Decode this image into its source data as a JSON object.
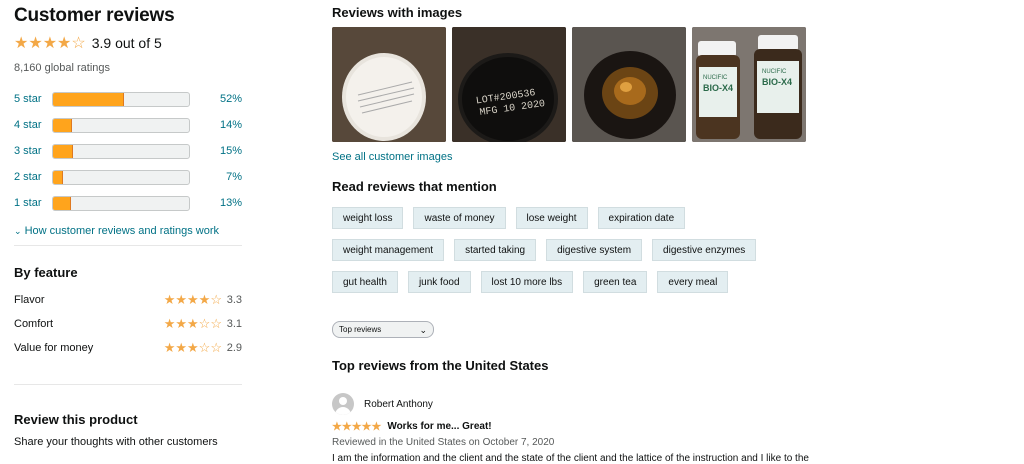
{
  "summary": {
    "title": "Customer reviews",
    "stars": "★★★★☆",
    "rating_text": "3.9 out of 5",
    "global_ratings": "8,160 global ratings",
    "histogram": [
      {
        "label": "5 star",
        "percent": 52,
        "pct_text": "52%"
      },
      {
        "label": "4 star",
        "percent": 14,
        "pct_text": "14%"
      },
      {
        "label": "3 star",
        "percent": 15,
        "pct_text": "15%"
      },
      {
        "label": "2 star",
        "percent": 7,
        "pct_text": "7%"
      },
      {
        "label": "1 star",
        "percent": 13,
        "pct_text": "13%"
      }
    ],
    "how_link": "How customer reviews and ratings work"
  },
  "by_feature": {
    "title": "By feature",
    "items": [
      {
        "label": "Flavor",
        "stars": "★★★★☆",
        "value": "3.3"
      },
      {
        "label": "Comfort",
        "stars": "★★★☆☆",
        "value": "3.1"
      },
      {
        "label": "Value for money",
        "stars": "★★★☆☆",
        "value": "2.9"
      }
    ]
  },
  "review_product": {
    "title": "Review this product",
    "subtitle": "Share your thoughts with other customers"
  },
  "images": {
    "title": "Reviews with images",
    "see_all": "See all customer images",
    "thumb_texts": {
      "thumb2_line1": "LOT#200536",
      "thumb2_line2": "MFG 10 2020",
      "thumb4_brand": "NUCIFIC",
      "thumb4_product": "BIO-X4"
    }
  },
  "mentions": {
    "title": "Read reviews that mention",
    "chips": [
      "weight loss",
      "waste of money",
      "lose weight",
      "expiration date",
      "weight management",
      "started taking",
      "digestive system",
      "digestive enzymes",
      "gut health",
      "junk food",
      "lost 10 more lbs",
      "green tea",
      "every meal"
    ]
  },
  "sort": {
    "selected": "Top reviews"
  },
  "reviews": {
    "section_title": "Top reviews from the United States",
    "first": {
      "author": "Robert Anthony",
      "stars": "★★★★★",
      "title": "Works for me... Great!",
      "meta": "Reviewed in the United States on October 7, 2020",
      "snippet": "I am the information and the client and the state of the client and the lattice of the instruction and I like to the"
    }
  },
  "colors": {
    "star": "#f3a847",
    "bar_fill": "#ffa41c",
    "link": "#007185",
    "chip_bg": "#e3eef1"
  }
}
